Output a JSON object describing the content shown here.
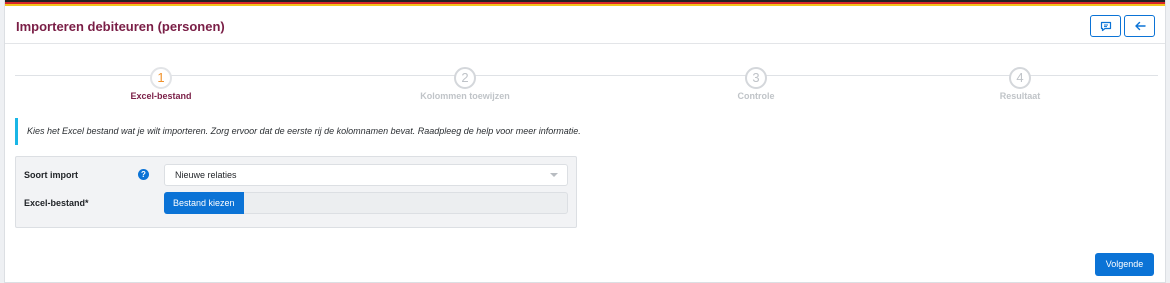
{
  "colors": {
    "accent": "#0b73d6",
    "title": "#7a1e46",
    "active_step": "#f0922c",
    "info_border": "#19b6e6"
  },
  "header": {
    "title": "Importeren debiteuren (personen)",
    "icons": [
      "comment-icon",
      "arrow-left-icon"
    ]
  },
  "steps": [
    {
      "number": "1",
      "label": "Excel-bestand",
      "active": true
    },
    {
      "number": "2",
      "label": "Kolommen toewijzen",
      "active": false
    },
    {
      "number": "3",
      "label": "Controle",
      "active": false
    },
    {
      "number": "4",
      "label": "Resultaat",
      "active": false
    }
  ],
  "info": {
    "text": "Kies het Excel bestand wat je wilt importeren. Zorg ervoor dat de eerste rij de kolomnamen bevat. Raadpleeg de help voor meer informatie."
  },
  "form": {
    "import_type_label": "Soort import",
    "help_icon": "?",
    "import_type_value": "Nieuwe relaties",
    "file_label": "Excel-bestand*",
    "file_button": "Bestand kiezen"
  },
  "footer": {
    "next_label": "Volgende"
  }
}
